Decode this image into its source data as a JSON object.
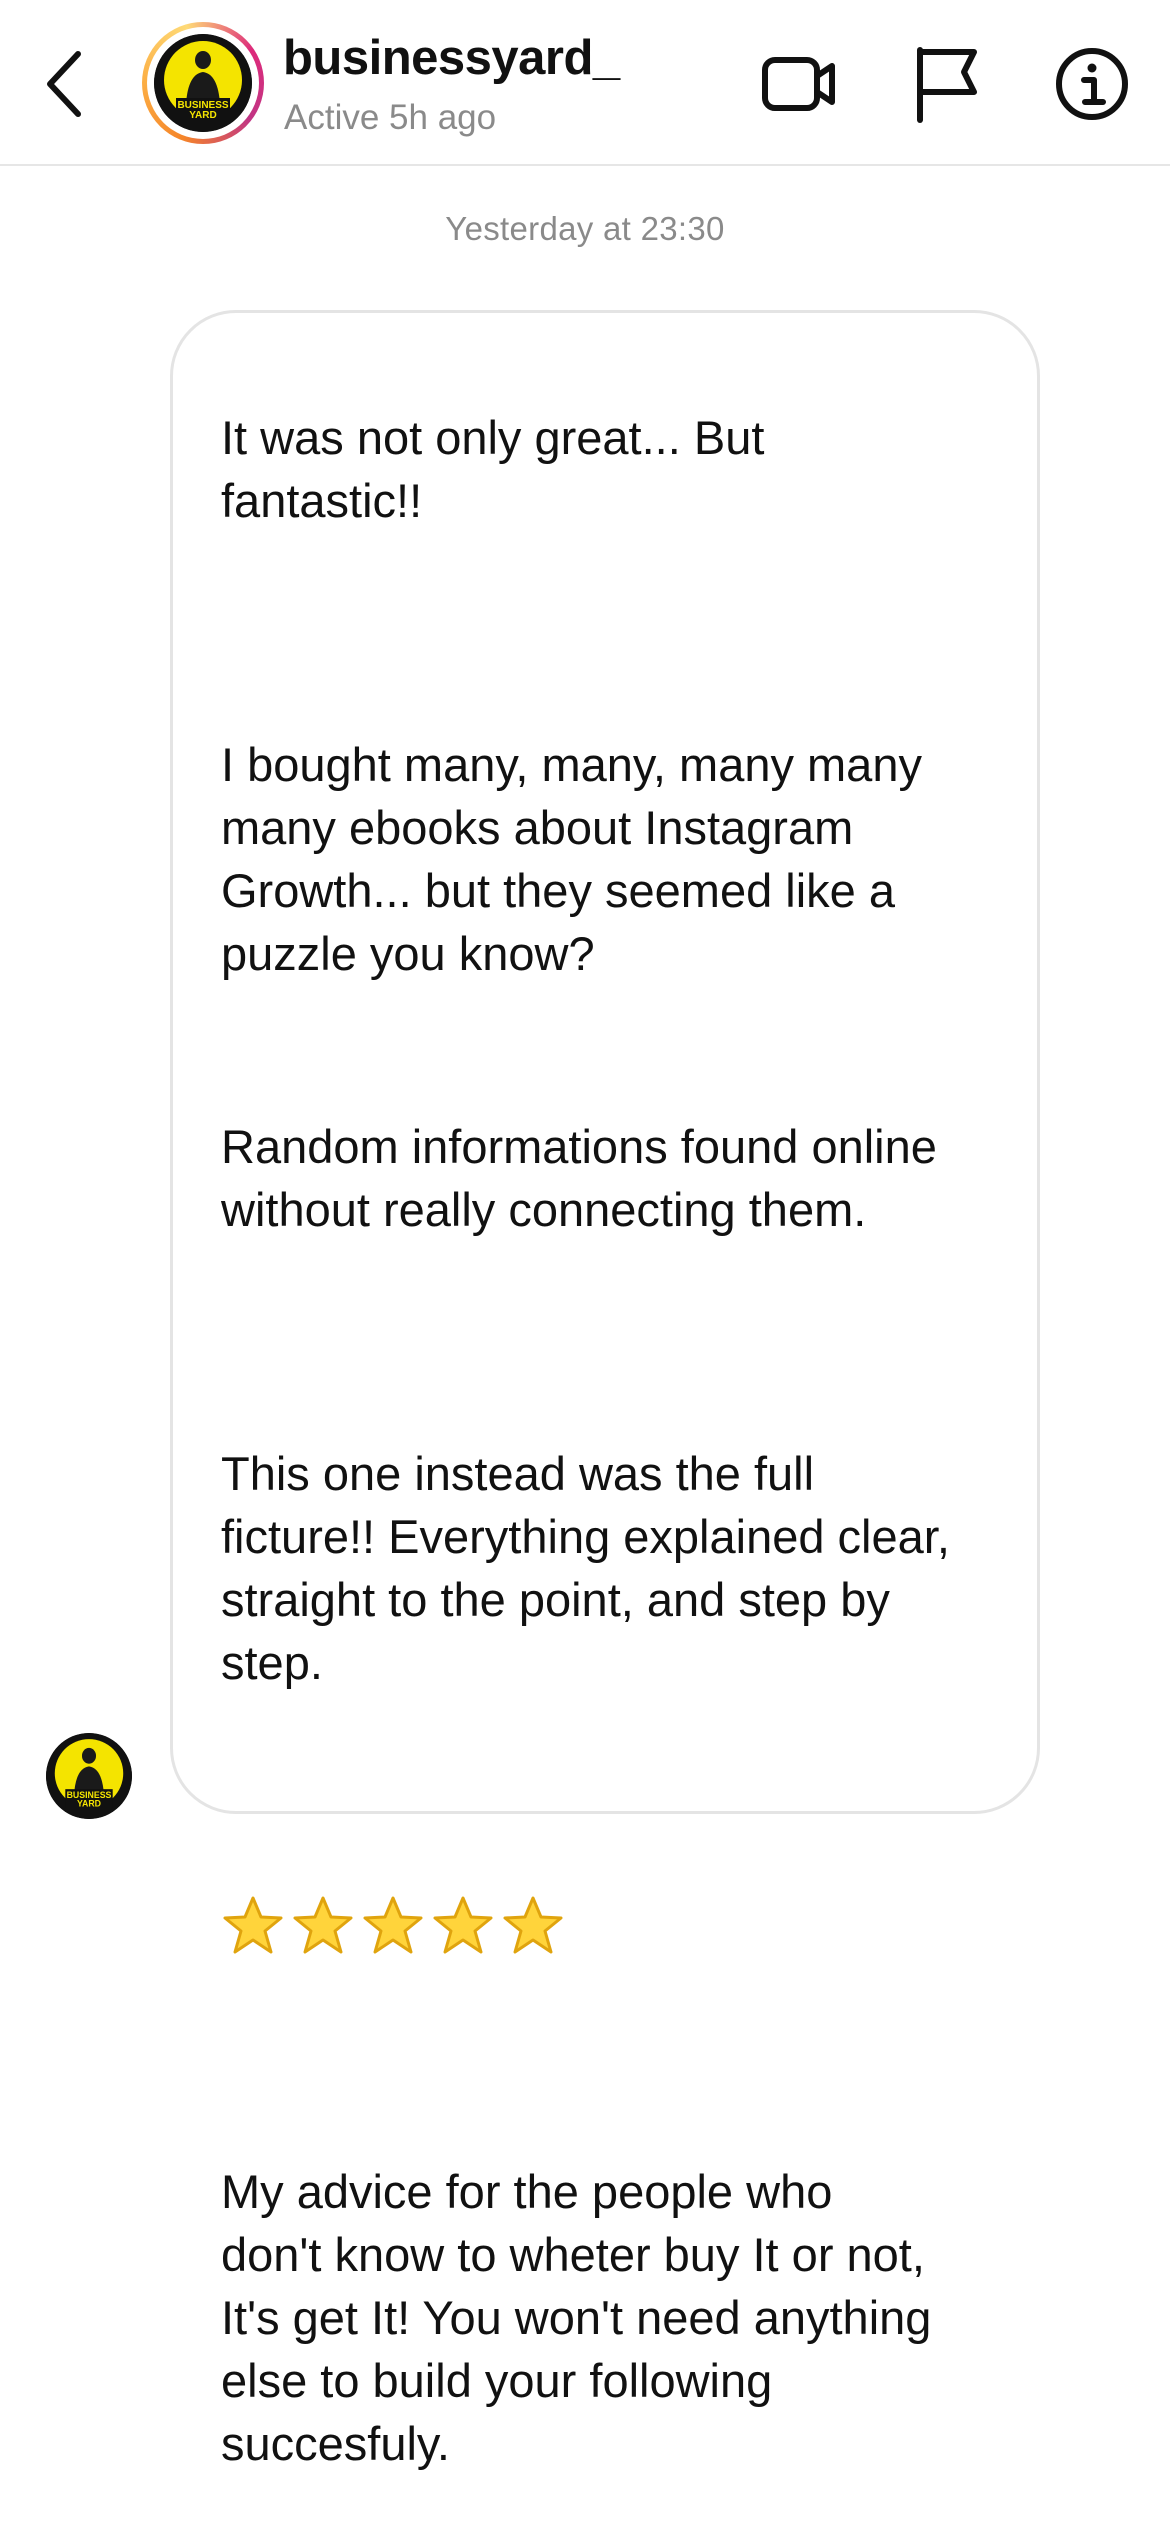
{
  "header": {
    "username": "businessyard_",
    "status": "Active 5h ago",
    "avatar_logo_text": [
      "BUSINESS",
      "YARD"
    ],
    "icons": [
      "back-chevron-icon",
      "video-call-icon",
      "flag-report-icon",
      "info-icon"
    ]
  },
  "thread": {
    "timestamp": "Yesterday at 23:30"
  },
  "message": {
    "paragraph_1": "It was not only great... But\nfantastic!!",
    "paragraph_2": "I bought many, many, many many\nmany ebooks about Instagram\nGrowth...  but they seemed like a\npuzzle you know?",
    "paragraph_3": "Random informations found online\nwithout really connecting them.",
    "paragraph_4": "This one instead was the full\nficture!! Everything explained clear,\nstraight to the point, and step by\nstep.",
    "rating_stars": 5,
    "paragraph_5": "My advice for the people who\ndon't know to wheter buy It or not,\nIt's get It! You won't need anything\nelse to build your following\nsuccesfuly."
  },
  "colors": {
    "star_fill": "#FFD43B",
    "star_stroke": "#E0A40E",
    "avatar_yellow": "#F4E400",
    "muted_text": "#8a8a8a",
    "bubble_border": "#e4e4e4"
  }
}
